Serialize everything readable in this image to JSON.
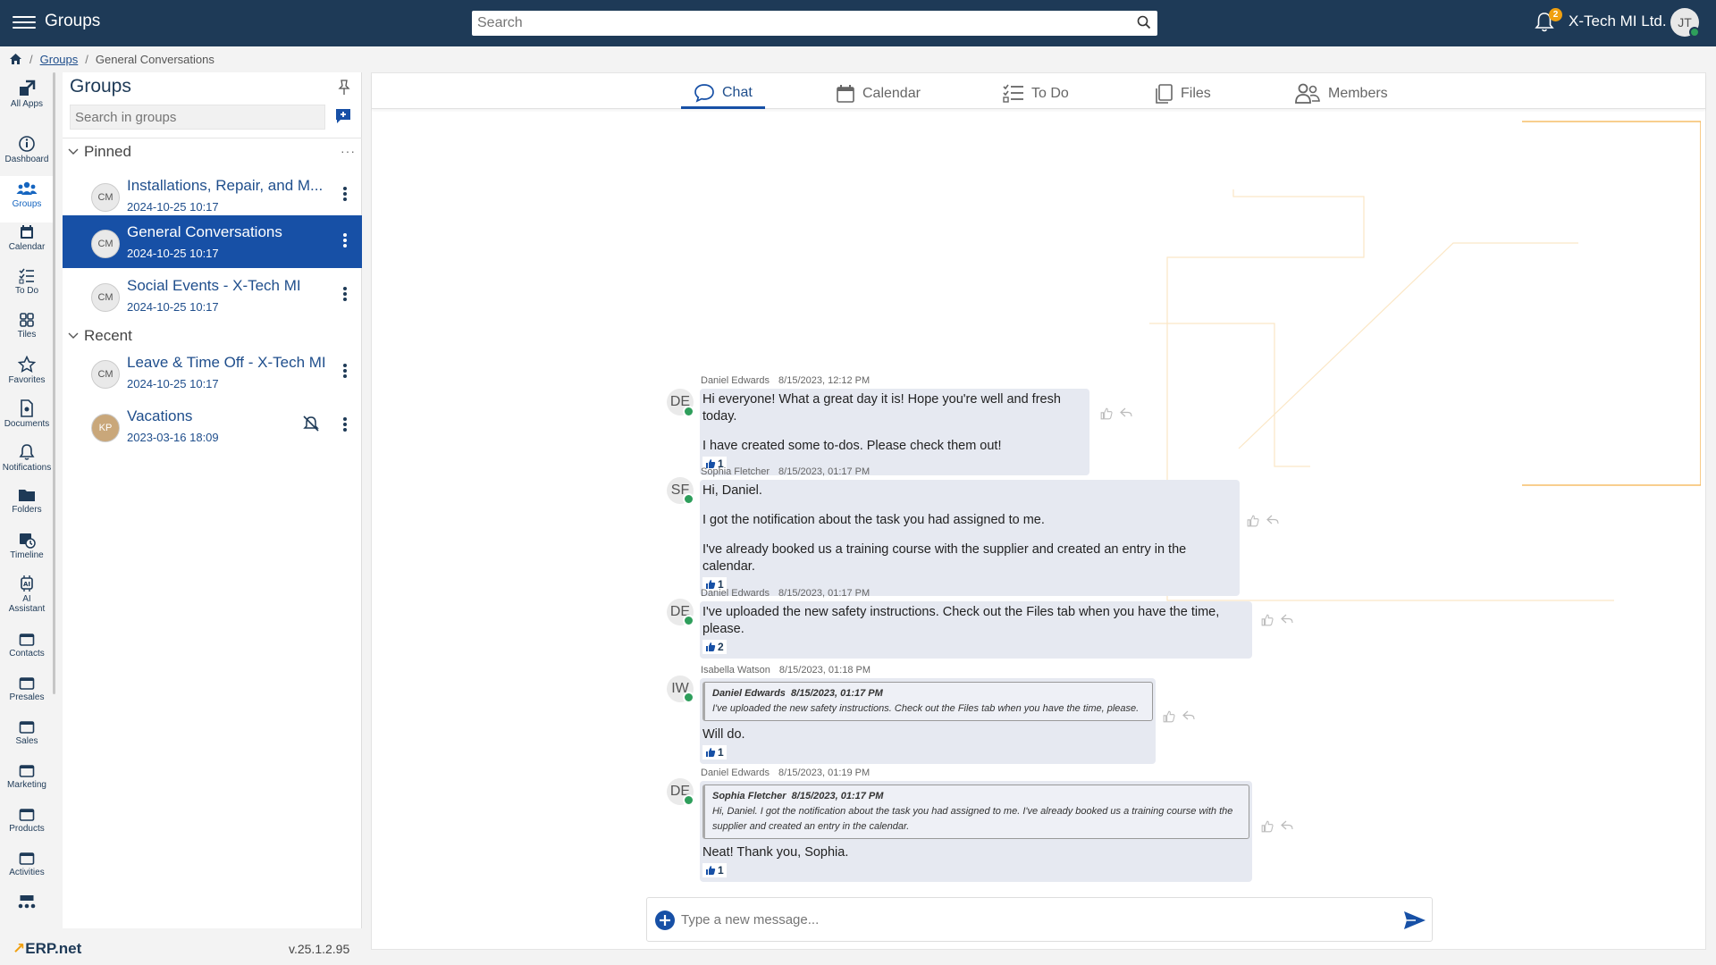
{
  "topbar": {
    "title": "Groups",
    "search_placeholder": "Search",
    "notifications_count": "2",
    "company": "X-Tech MI Ltd.",
    "user_initials": "JT"
  },
  "breadcrumb": {
    "groups": "Groups",
    "current": "General Conversations"
  },
  "rail": {
    "items": [
      {
        "label": "All Apps",
        "icon": "all-apps-icon"
      },
      {
        "label": "Dashboard",
        "icon": "info-icon"
      },
      {
        "label": "Groups",
        "icon": "groups-icon"
      },
      {
        "label": "Calendar",
        "icon": "calendar-icon"
      },
      {
        "label": "To Do",
        "icon": "todo-icon"
      },
      {
        "label": "Tiles",
        "icon": "tiles-icon"
      },
      {
        "label": "Favorites",
        "icon": "star-icon"
      },
      {
        "label": "Documents",
        "icon": "document-icon"
      },
      {
        "label": "Notifications",
        "icon": "bell-icon"
      },
      {
        "label": "Folders",
        "icon": "folder-icon"
      },
      {
        "label": "Timeline",
        "icon": "timeline-icon"
      },
      {
        "label": "AI",
        "label2": "Assistant",
        "icon": "ai-icon"
      },
      {
        "label": "Contacts",
        "icon": "window-icon"
      },
      {
        "label": "Presales",
        "icon": "window-icon"
      },
      {
        "label": "Sales",
        "icon": "window-icon"
      },
      {
        "label": "Marketing",
        "icon": "window-icon"
      },
      {
        "label": "Products",
        "icon": "window-icon"
      },
      {
        "label": "Activities",
        "icon": "window-icon"
      }
    ],
    "logo_mark": "ERP",
    "logo_text": ".net",
    "version": "v.25.1.2.95"
  },
  "groups_panel": {
    "title": "Groups",
    "search_placeholder": "Search in groups",
    "pinned_label": "Pinned",
    "recent_label": "Recent",
    "pinned": [
      {
        "name": "Installations, Repair, and M...",
        "date": "2024-10-25 10:17",
        "avatar": "CM"
      },
      {
        "name": "General Conversations",
        "date": "2024-10-25 10:17",
        "avatar": "CM",
        "active": true
      },
      {
        "name": "Social Events - X-Tech MI",
        "date": "2024-10-25 10:17",
        "avatar": "CM"
      }
    ],
    "recent": [
      {
        "name": "Leave & Time Off - X-Tech MI",
        "date": "2024-10-25 10:17",
        "avatar": "CM"
      },
      {
        "name": "Vacations",
        "date": "2023-03-16 18:09",
        "avatar": "KP"
      }
    ]
  },
  "tabs": [
    {
      "label": "Chat",
      "icon": "chat-icon",
      "active": true
    },
    {
      "label": "Calendar",
      "icon": "calendar-icon"
    },
    {
      "label": "To Do",
      "icon": "todo-icon"
    },
    {
      "label": "Files",
      "icon": "files-icon"
    },
    {
      "label": "Members",
      "icon": "members-icon"
    }
  ],
  "messages": [
    {
      "initials": "DE",
      "author": "Daniel Edwards",
      "time": "8/15/2023, 12:12 PM",
      "lines": [
        "Hi everyone! What a great day it is! Hope you're well and fresh today.",
        "I have created some to-dos. Please check them out!"
      ],
      "likes": "1"
    },
    {
      "initials": "SF",
      "author": "Sophia Fletcher",
      "time": "8/15/2023, 01:17 PM",
      "lines": [
        "Hi, Daniel.",
        "I got the notification about the task you had assigned to me.",
        "I've already booked us a training course with the supplier and created an entry in the calendar."
      ],
      "likes": "1"
    },
    {
      "initials": "DE",
      "author": "Daniel Edwards",
      "time": "8/15/2023, 01:17 PM",
      "lines": [
        "I've uploaded the new safety instructions. Check out the Files tab when you have the time, please."
      ],
      "likes": "2"
    },
    {
      "initials": "IW",
      "author": "Isabella Watson",
      "time": "8/15/2023, 01:18 PM",
      "quote_author": "Daniel Edwards",
      "quote_time": "8/15/2023, 01:17 PM",
      "quote_text": "I've uploaded the new safety instructions. Check out the Files tab when you have the time, please.",
      "lines": [
        "Will do."
      ],
      "likes": "1"
    },
    {
      "initials": "DE",
      "author": "Daniel Edwards",
      "time": "8/15/2023, 01:19 PM",
      "quote_author": "Sophia Fletcher",
      "quote_time": "8/15/2023, 01:17 PM",
      "quote_text": "Hi, Daniel. I got the notification about the task you had assigned to me. I've already booked us a training course with the supplier and created an entry in the calendar.",
      "lines": [
        "Neat! Thank you, Sophia."
      ],
      "likes": "1"
    }
  ],
  "composer": {
    "placeholder": "Type a new message..."
  },
  "colors": {
    "topbar": "#1e3a57",
    "accent": "#1750a6",
    "online": "#2e9e5b",
    "badge": "#f0a010"
  }
}
